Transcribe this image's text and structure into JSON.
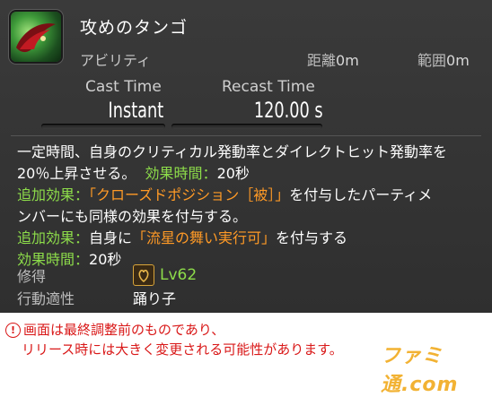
{
  "action": {
    "name": "攻めのタンゴ",
    "type": "アビリティ",
    "range_label": "距離",
    "range_value": "0m",
    "radius_label": "範囲",
    "radius_value": "0m",
    "icon": "dance-action-icon"
  },
  "timing": {
    "cast_label": "Cast Time",
    "cast_value": "Instant",
    "recast_label": "Recast Time",
    "recast_value": "120.00 s"
  },
  "description": {
    "line1": "一定時間、自身のクリティカル発動率とダイレクトヒット発動率を",
    "line2a": "20％上昇させる。",
    "line2b": "効果時間：",
    "line2c": "20秒",
    "line3a": "追加効果：",
    "line3b": "「クローズドポジション［被］」",
    "line3c": "を付与したパーティメ",
    "line4": "ンバーにも同様の効果を付与する。",
    "line5a": "追加効果：",
    "line5b": "自身に",
    "line5c": "「流星の舞い実行可」",
    "line5d": "を付与する",
    "line6a": "効果時間：",
    "line6b": "20秒"
  },
  "meta": {
    "acquire_label": "修得",
    "acquire_level": "Lv62",
    "acquire_icon": "dancer-job-icon",
    "affinity_label": "行動適性",
    "affinity_value": "踊り子"
  },
  "notice": {
    "line1": "画面は最終調整前のものであり、",
    "line2": "リリース時には大きく変更される可能性があります。"
  },
  "watermark": "ファミ通.com",
  "colors": {
    "panel": "#333333",
    "effect_green": "#8ddc4a",
    "status_orange": "#ff9a26",
    "notice_red": "#d91818"
  }
}
